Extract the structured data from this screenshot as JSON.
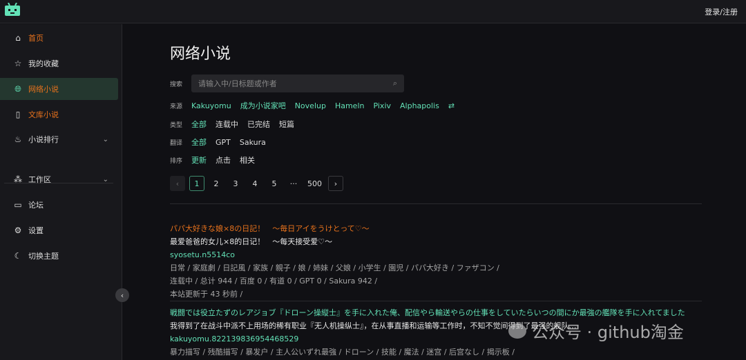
{
  "header": {
    "login": "登录/注册"
  },
  "sidebar": {
    "items": [
      {
        "label": "首页",
        "icon": "home-icon"
      },
      {
        "label": "我的收藏",
        "icon": "star-icon"
      },
      {
        "label": "网络小说",
        "icon": "globe-icon"
      },
      {
        "label": "文库小说",
        "icon": "book-icon"
      },
      {
        "label": "小说排行",
        "icon": "fire-icon"
      },
      {
        "label": "工作区",
        "icon": "workspace-icon"
      },
      {
        "label": "论坛",
        "icon": "forum-icon"
      },
      {
        "label": "设置",
        "icon": "gear-icon"
      },
      {
        "label": "切换主题",
        "icon": "moon-icon"
      }
    ]
  },
  "main": {
    "title": "网络小说",
    "search": {
      "label": "搜索",
      "placeholder": "请输入中/日标题或作者"
    },
    "source": {
      "label": "来源",
      "options": [
        "Kakuyomu",
        "成为小说家吧",
        "Novelup",
        "Hameln",
        "Pixiv",
        "Alphapolis"
      ]
    },
    "type": {
      "label": "类型",
      "options": [
        "全部",
        "连载中",
        "已完结",
        "短篇"
      ]
    },
    "translate": {
      "label": "翻译",
      "options": [
        "全部",
        "GPT",
        "Sakura"
      ]
    },
    "sort": {
      "label": "排序",
      "options": [
        "更新",
        "点击",
        "相关"
      ]
    },
    "pagination": {
      "current": "1",
      "pages": [
        "1",
        "2",
        "3",
        "4",
        "5",
        "···",
        "500"
      ]
    },
    "novels": [
      {
        "title_jp": "パパ大好きな娘×8の日記！　～毎日アイをうけとって♡～",
        "title_zh": "最爱爸爸的女儿×8的日记！　～每天接受爱♡～",
        "id": "syosetu.n5514co",
        "tags": "日常 / 家庭劇 / 日記風 / 家族 / 親子 / 娘 / 姉妹 / 父娘 / 小学生 / 園児 / パパ大好き / ファザコン /",
        "stats": "连载中 / 总计 944 / 百度 0 / 有道 0 / GPT 0 / Sakura 942 /",
        "updated": "本站更新于 43 秒前 /"
      },
      {
        "title_jp": "戦闘では役立たずのレアジョブ『ドローン操縦士』を手に入れた俺、配信やら輸送やらの仕事をしていたらいつの間にか最強の艦隊を手に入れてました",
        "title_zh": "我得到了在战斗中派不上用场的稀有职业『无人机操纵士』，在从事直播和运输等工作时，不知不觉间得到了最强的舰队…",
        "id": "kakuyomu.822139836954468529",
        "tags": "暴力描写 / 残酷描写 / 暴发户 / 主人公いずれ最強 / ドローン / 技能 / 魔法 / 迷宫 / 后宫なし / 揭示板 /"
      }
    ]
  },
  "watermark": "公众号 · github淘金"
}
